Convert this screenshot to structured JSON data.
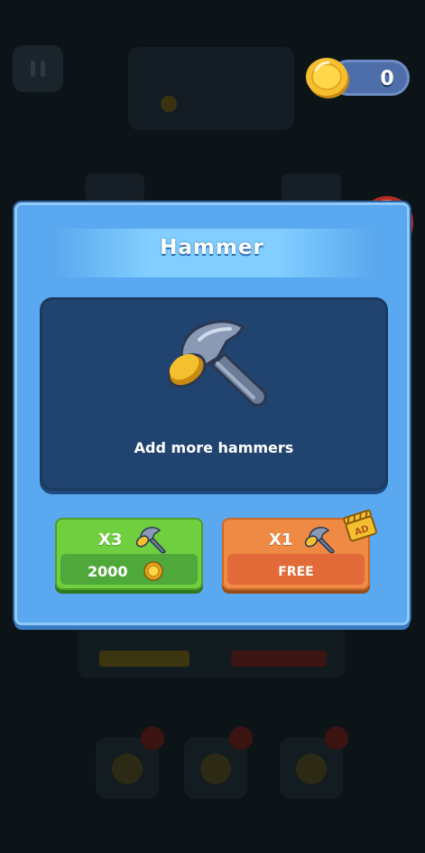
{
  "header": {
    "coins": "0"
  },
  "dialog": {
    "title": "Hammer",
    "description": "Add more hammers",
    "options": [
      {
        "quantity": "X3",
        "price": "2000",
        "price_icon": "coin-icon",
        "color": "#6fcf3e"
      },
      {
        "quantity": "X1",
        "price": "FREE",
        "badge": "AD",
        "color": "#ef8a45"
      }
    ]
  },
  "colors": {
    "dialog_bg": "#5aa8ef",
    "panel_bg": "#20446f",
    "close_button": "#e64a3a",
    "coin_gold": "#f5b82e"
  }
}
